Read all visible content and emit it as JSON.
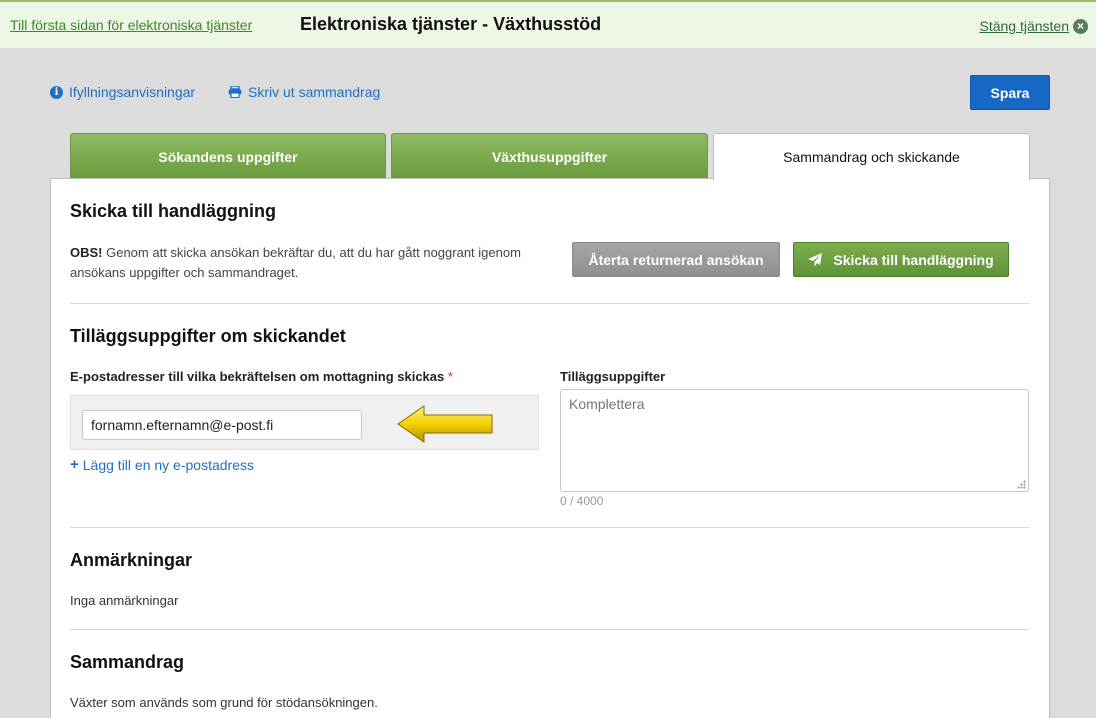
{
  "topbar": {
    "home_link": "Till första sidan för elektroniska tjänster",
    "title": "Elektroniska tjänster - Växthusstöd",
    "close_link": "Stäng tjänsten"
  },
  "toolbar": {
    "instructions": "Ifyllningsanvisningar",
    "print": "Skriv ut sammandrag",
    "save": "Spara"
  },
  "tabs": [
    {
      "label": "Sökandens uppgifter"
    },
    {
      "label": "Växthusuppgifter"
    },
    {
      "label": "Sammandrag och skickande"
    }
  ],
  "send_section": {
    "title": "Skicka till handläggning",
    "notice_bold": "OBS!",
    "notice_text": " Genom att skicka ansökan bekräftar du, att du har gått noggrant igenom ansökans uppgifter och sammandraget.",
    "restore_button": "Återta returnerad ansökan",
    "send_button": "Skicka till handläggning"
  },
  "extra_section": {
    "title": "Tilläggsuppgifter om skickandet",
    "email_label": "E-postadresser till vilka bekräftelsen om mottagning skickas",
    "required_marker": "*",
    "email_value": "fornamn.efternamn@e-post.fi",
    "add_email": "Lägg till en ny e-postadress",
    "extra_label": "Tilläggsuppgifter",
    "extra_placeholder": "Komplettera",
    "char_count": "0 / 4000"
  },
  "remarks": {
    "title": "Anmärkningar",
    "text": "Inga anmärkningar"
  },
  "summary": {
    "title": "Sammandrag",
    "text": "Växter som används som grund för stödansökningen."
  },
  "colors": {
    "accent_green": "#6a9a3c",
    "link_blue": "#1f6fc4",
    "save_blue": "#1668c4",
    "arrow_yellow": "#f2d000"
  }
}
